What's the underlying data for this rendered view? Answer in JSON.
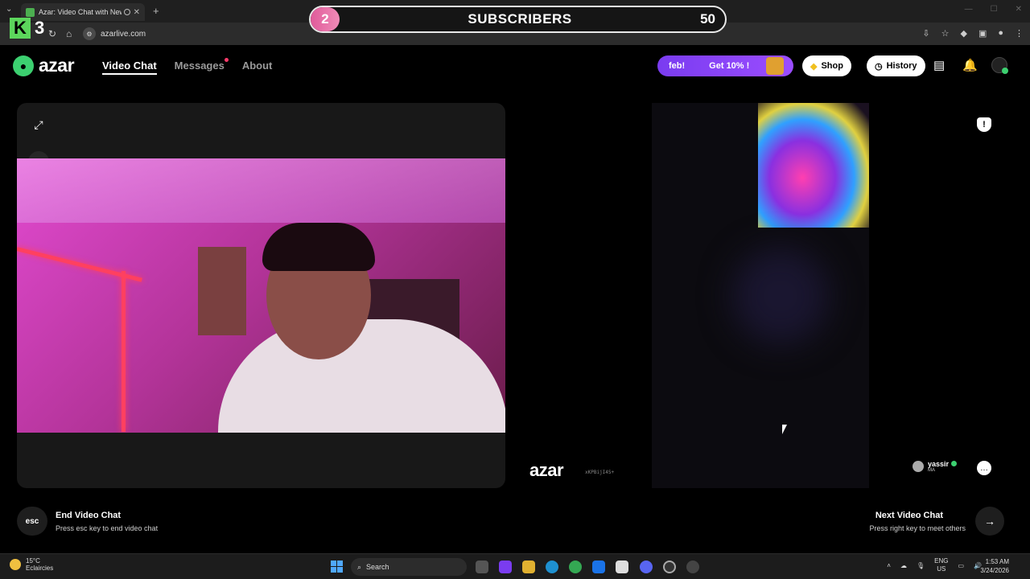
{
  "browser": {
    "tab_title": "Azar: Video Chat with New",
    "url": "azarlive.com"
  },
  "overlay": {
    "current": "2",
    "label": "SUBSCRIBERS",
    "goal": "50",
    "counter": "3"
  },
  "header": {
    "brand": "azar",
    "nav": [
      "Video Chat",
      "Messages",
      "About"
    ],
    "promo_left": "feb!",
    "promo_right": "Get 10% !",
    "shop": "Shop",
    "history": "History"
  },
  "remote": {
    "watermark": "azar",
    "watermark_id": "xKPBijI4S+",
    "peer_name": "yassir",
    "peer_country": "MA"
  },
  "controls": {
    "esc_key": "esc",
    "end_title": "End Video Chat",
    "end_sub": "Press esc key to end video chat",
    "next_title": "Next Video Chat",
    "next_sub": "Press right key to meet others"
  },
  "taskbar": {
    "temp": "15°C",
    "weather": "Eclaircies",
    "search": "Search",
    "lang1": "ENG",
    "lang2": "US",
    "time": "1:53 AM",
    "date": "3/24/2026"
  },
  "colors": {
    "accent_green": "#3cd070",
    "promo_purple": "#7a3cf0",
    "subs_pink": "#e05a9a"
  }
}
